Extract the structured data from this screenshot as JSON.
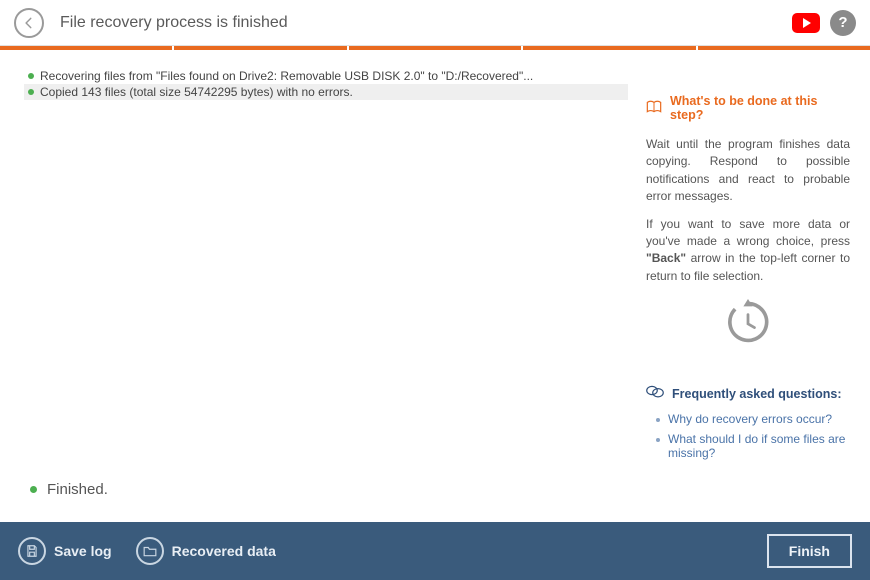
{
  "header": {
    "title": "File recovery process is finished"
  },
  "log": {
    "lines": [
      "Recovering files from \"Files found on Drive2: Removable USB DISK 2.0\" to \"D:/Recovered\"...",
      "Copied 143 files (total size 54742295 bytes) with no errors."
    ]
  },
  "status": "Finished.",
  "info": {
    "heading": "What's to be done at this step?",
    "p1": "Wait until the program finishes data copying. Respond to possible notifications and react to probable error messages.",
    "p2_a": "If you want to save more data or you've made a wrong choice, press ",
    "p2_bold": "\"Back\"",
    "p2_b": " arrow in the top-left corner to return to file selection."
  },
  "faq": {
    "heading": "Frequently asked questions:",
    "items": [
      "Why do recovery errors occur?",
      "What should I do if some files are missing?"
    ]
  },
  "footer": {
    "save_log": "Save log",
    "recovered_data": "Recovered data",
    "finish": "Finish"
  }
}
